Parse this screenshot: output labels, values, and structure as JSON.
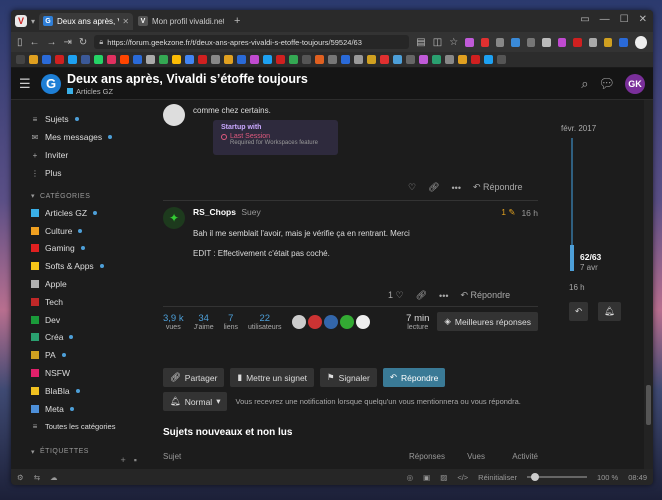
{
  "browser": {
    "tabs": [
      {
        "title": "Deux ans après, Vivaldi s'ét",
        "favicon": "G"
      },
      {
        "title": "Mon profil vivaldi.net",
        "favicon": "V"
      }
    ],
    "url": "https://forum.geekzone.fr/t/deux-ans-apres-vivaldi-s-etoffe-toujours/59524/63"
  },
  "header": {
    "title": "Deux ans après, Vivaldi s’étoffe toujours",
    "category": "Articles GZ",
    "user_initials": "GK"
  },
  "sidebar": {
    "nav": [
      {
        "label": "Sujets",
        "icon": "topics-icon",
        "dot": true
      },
      {
        "label": "Mes messages",
        "icon": "mail-icon",
        "dot": true
      },
      {
        "label": "Inviter",
        "icon": "invite-icon",
        "dot": false
      },
      {
        "label": "Plus",
        "icon": "more-icon",
        "dot": false
      }
    ],
    "categories_header": "CATÉGORIES",
    "categories": [
      {
        "label": "Articles GZ",
        "color": "#3ab0e8",
        "dot": true
      },
      {
        "label": "Culture",
        "color": "#f0a020",
        "dot": true
      },
      {
        "label": "Gaming",
        "color": "#e02020",
        "dot": true
      },
      {
        "label": "Softs & Apps",
        "color": "#f5c518",
        "dot": true
      },
      {
        "label": "Apple",
        "color": "#b0b0b0",
        "dot": false
      },
      {
        "label": "Tech",
        "color": "#c02828",
        "dot": false
      },
      {
        "label": "Dev",
        "color": "#1a9a3a",
        "dot": false
      },
      {
        "label": "Créa",
        "color": "#2aa070",
        "dot": true
      },
      {
        "label": "PA",
        "color": "#d0a020",
        "dot": true
      },
      {
        "label": "NSFW",
        "color": "#e0206a",
        "dot": false
      },
      {
        "label": "BlaBla",
        "color": "#f0c020",
        "dot": true
      },
      {
        "label": "Meta",
        "color": "#4d8fd8",
        "dot": true
      }
    ],
    "all_categories": "Toutes les catégories",
    "tags_header": "ÉTIQUETTES"
  },
  "posts": [
    {
      "text": "comme chez certains.",
      "startup": {
        "title": "Startup with",
        "option": "Last Session",
        "note": "Required for Workspaces feature"
      },
      "reply_label": "Répondre"
    },
    {
      "author": "RS_Chops",
      "username": "Suey",
      "edits": "1",
      "time": "16 h",
      "lines": [
        "Bah il me semblait l'avoir, mais je vérifie ça en rentrant. Merci",
        "EDIT : Effectivement c'était pas coché."
      ],
      "likes": "1",
      "reply_label": "Répondre"
    }
  ],
  "stats": {
    "views": {
      "n": "3,9 k",
      "l": "vues"
    },
    "likes": {
      "n": "34",
      "l": "J'aime"
    },
    "links": {
      "n": "7",
      "l": "liens"
    },
    "users": {
      "n": "22",
      "l": "utilisateurs"
    },
    "read_time": {
      "n": "7 min",
      "l": "lecture"
    },
    "best_label": "Meilleures réponses"
  },
  "footer_buttons": {
    "share": "Partager",
    "bookmark": "Mettre un signet",
    "flag": "Signaler",
    "reply": "Répondre"
  },
  "notification": {
    "level": "Normal",
    "text": "Vous recevrez une notification lorsque quelqu'un vous mentionnera ou vous répondra."
  },
  "suggested": {
    "title": "Sujets nouveaux et non lus",
    "col_topic": "Sujet",
    "col_replies": "Réponses",
    "col_views": "Vues",
    "col_activity": "Activité"
  },
  "timeline": {
    "start": "févr. 2017",
    "position": "62/63",
    "position_date": "7 avr",
    "end": "16 h"
  },
  "statusbar": {
    "reset": "Réinitialiser",
    "zoom": "100 %",
    "clock": "08:49"
  }
}
